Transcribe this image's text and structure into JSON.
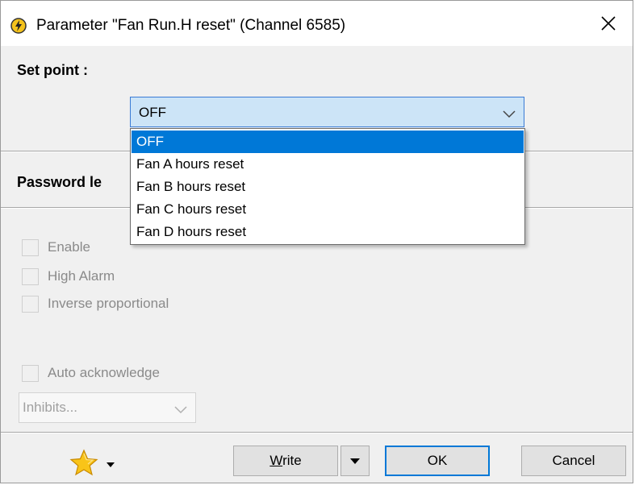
{
  "window": {
    "title": "Parameter \"Fan Run.H reset\" (Channel 6585)",
    "icon": "lightning-icon",
    "close_icon": "close-icon"
  },
  "setpoint": {
    "label": "Set point :",
    "value": "OFF",
    "options": [
      "OFF",
      "Fan A hours reset",
      "Fan B hours reset",
      "Fan C hours reset",
      "Fan D hours reset"
    ],
    "selected_index": 0
  },
  "password": {
    "label": "Password le"
  },
  "checkboxes": [
    {
      "label": "Enable",
      "checked": false
    },
    {
      "label": "High Alarm",
      "checked": false
    },
    {
      "label": "Inverse proportional",
      "checked": false
    },
    {
      "label": "Auto acknowledge",
      "checked": false
    }
  ],
  "inhibits": {
    "value": "Inhibits..."
  },
  "footer": {
    "favorite_icon": "star-icon",
    "write_prefix": "W",
    "write_rest": "rite",
    "ok_label": "OK",
    "cancel_label": "Cancel"
  },
  "colors": {
    "accent": "#0078d7",
    "combo_bg": "#cce4f7",
    "window_bg": "#f0f0f0"
  }
}
